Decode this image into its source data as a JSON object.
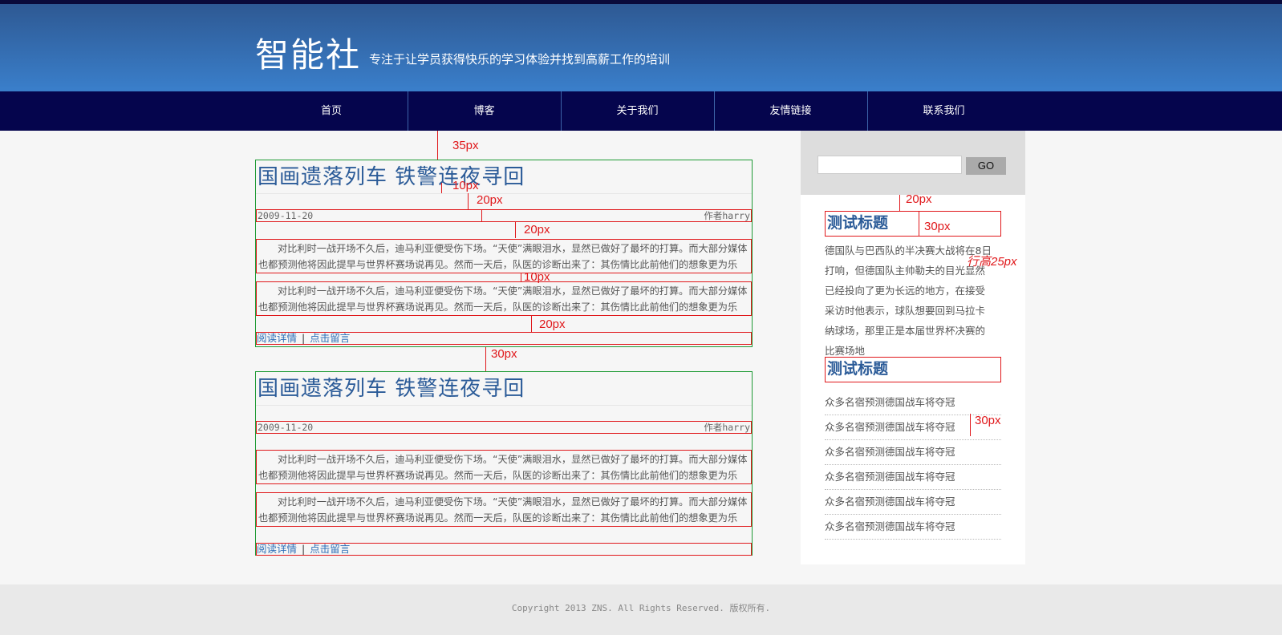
{
  "header": {
    "logo": "智能社",
    "slogan": "专注于让学员获得快乐的学习体验并找到高薪工作的培训"
  },
  "nav": [
    "首页",
    "博客",
    "关于我们",
    "友情链接",
    "联系我们"
  ],
  "posts": [
    {
      "title": "国画遗落列车 铁警连夜寻回",
      "date": "2009-11-20",
      "author": "作者harry",
      "paragraphs": [
        "对比利时一战开场不久后，迪马利亚便受伤下场。“天使”满眼泪水，显然已做好了最坏的打算。而大部分媒体也都预测他将因此提早与世界杯赛场说再见。然而一天后，队医的诊断出来了：其伤情比此前他们的想象更为乐观。",
        "对比利时一战开场不久后，迪马利亚便受伤下场。“天使”满眼泪水，显然已做好了最坏的打算。而大部分媒体也都预测他将因此提早与世界杯赛场说再见。然而一天后，队医的诊断出来了：其伤情比此前他们的想象更为乐观。"
      ],
      "read_more": "阅读详情",
      "sep": "|",
      "comment": "点击留言"
    },
    {
      "title": "国画遗落列车 铁警连夜寻回",
      "date": "2009-11-20",
      "author": "作者harry",
      "paragraphs": [
        "对比利时一战开场不久后，迪马利亚便受伤下场。“天使”满眼泪水，显然已做好了最坏的打算。而大部分媒体也都预测他将因此提早与世界杯赛场说再见。然而一天后，队医的诊断出来了：其伤情比此前他们的想象更为乐观。",
        "对比利时一战开场不久后，迪马利亚便受伤下场。“天使”满眼泪水，显然已做好了最坏的打算。而大部分媒体也都预测他将因此提早与世界杯赛场说再见。然而一天后，队医的诊断出来了：其伤情比此前他们的想象更为乐观。"
      ],
      "read_more": "阅读详情",
      "sep": "|",
      "comment": "点击留言"
    }
  ],
  "sidebar": {
    "search_button": "GO",
    "section1_title": "测试标题",
    "section1_text": "德国队与巴西队的半决赛大战将在8日打响，但德国队主帅勒夫的目光显然已经投向了更为长远的地方，在接受采访时他表示，球队想要回到马拉卡纳球场，那里正是本届世界杯决赛的比赛场地",
    "section2_title": "测试标题",
    "list": [
      "众多名宿预测德国战车将夺冠",
      "众多名宿预测德国战车将夺冠",
      "众多名宿预测德国战车将夺冠",
      "众多名宿预测德国战车将夺冠",
      "众多名宿预测德国战车将夺冠",
      "众多名宿预测德国战车将夺冠"
    ]
  },
  "annotations": {
    "a35": "35px",
    "a10": "10px",
    "a20": "20px",
    "a30": "30px",
    "line_height": "行高25px"
  },
  "footer": "Copyright 2013 ZNS. All Rights Reserved. 版权所有."
}
